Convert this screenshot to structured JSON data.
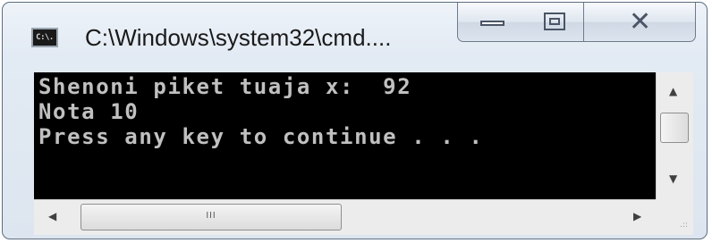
{
  "window": {
    "title": "C:\\Windows\\system32\\cmd....",
    "icon_label": "C:\\."
  },
  "caption_buttons": {
    "minimize_icon": "minimize-icon",
    "maximize_icon": "maximize-icon",
    "close_icon": "close-icon",
    "close_glyph": "✕"
  },
  "console": {
    "lines": [
      "Shenoni piket tuaja x:  92",
      "Nota 10",
      "Press any key to continue . . ."
    ],
    "background": "#000000",
    "foreground": "#c0c0c0"
  },
  "scrollbars": {
    "up_arrow": "▲",
    "down_arrow": "▼",
    "left_arrow": "◀",
    "right_arrow": "▶",
    "h_thumb_grip": "III",
    "resize_grip": ".::"
  }
}
